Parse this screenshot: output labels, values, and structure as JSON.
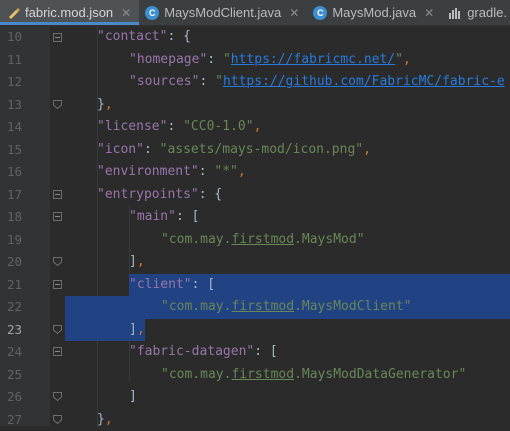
{
  "tabs": [
    {
      "label": "fabric.mod.json",
      "icon": "json-file-icon",
      "active": true
    },
    {
      "label": "MaysModClient.java",
      "icon": "java-class-icon",
      "active": false
    },
    {
      "label": "MaysMod.java",
      "icon": "java-class-icon",
      "active": false
    },
    {
      "label": "gradle.",
      "icon": "gradle-icon",
      "active": false
    }
  ],
  "line_numbers": [
    "10",
    "11",
    "12",
    "13",
    "14",
    "15",
    "16",
    "17",
    "18",
    "19",
    "20",
    "21",
    "22",
    "23",
    "24",
    "25",
    "26",
    "27"
  ],
  "current_line": "23",
  "code": {
    "contact_key": "\"contact\"",
    "homepage_key": "\"homepage\"",
    "homepage_val": "\"https://fabricmc.net/\"",
    "homepage_url": "https://fabricmc.net/",
    "sources_key": "\"sources\"",
    "sources_url": "https://github.com/FabricMC/fabric-e",
    "license_key": "\"license\"",
    "license_val": "\"CC0-1.0\"",
    "icon_key": "\"icon\"",
    "icon_val": "\"assets/mays-mod/icon.png\"",
    "environment_key": "\"environment\"",
    "environment_val": "\"*\"",
    "entrypoints_key": "\"entrypoints\"",
    "main_key": "\"main\"",
    "main_val_pre": "\"com.may.",
    "main_val_mid": "firstmod",
    "main_val_post": ".MaysMod\"",
    "client_key": "\"client\"",
    "client_val_pre": "\"com.may.",
    "client_val_mid": "firstmod",
    "client_val_post": ".MaysModClient\"",
    "datagen_key": "\"fabric-datagen\"",
    "datagen_val_pre": "\"com.may.",
    "datagen_val_mid": "firstmod",
    "datagen_val_post": ".MaysModDataGenerator\""
  },
  "colors": {
    "background": "#2b2b2b",
    "key": "#9876aa",
    "string": "#6a8759",
    "selection": "#214283"
  }
}
